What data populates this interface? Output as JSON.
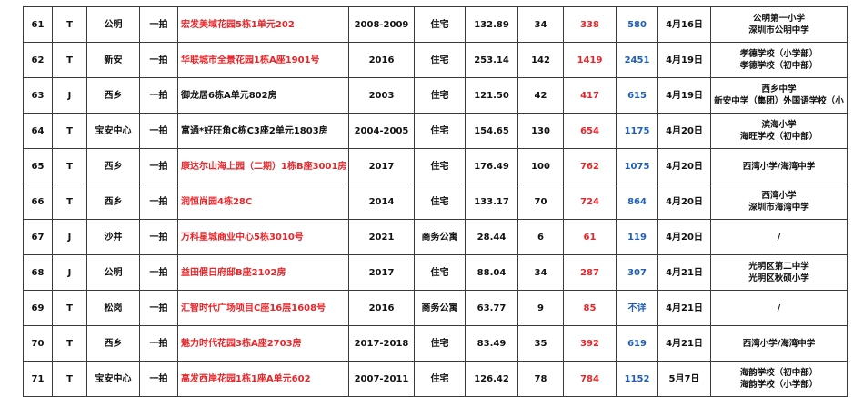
{
  "rows": [
    {
      "no": "61",
      "type": "T",
      "area": "公明",
      "auction": "一拍",
      "address": "宏发美域花园5栋1单元202",
      "address_red": true,
      "year": "2008-2009",
      "usage": "住宅",
      "size": "132.89",
      "age": "34",
      "price": "338",
      "unit": "580",
      "unit_red": false,
      "date": "4月16日",
      "schools": [
        "公明第一小学",
        "深圳市公明中学"
      ]
    },
    {
      "no": "62",
      "type": "T",
      "area": "新安",
      "auction": "一拍",
      "address": "华联城市全景花园1栋A座1901号",
      "address_red": true,
      "year": "2016",
      "usage": "住宅",
      "size": "253.14",
      "age": "142",
      "price": "1419",
      "unit": "2451",
      "unit_red": false,
      "date": "4月19日",
      "schools": [
        "孝德学校（小学部）",
        "孝德学校（初中部）"
      ]
    },
    {
      "no": "63",
      "type": "J",
      "area": "西乡",
      "auction": "一拍",
      "address": "御龙居6栋A单元802房",
      "address_red": false,
      "year": "2003",
      "usage": "住宅",
      "size": "121.50",
      "age": "42",
      "price": "417",
      "unit": "615",
      "unit_red": false,
      "date": "4月19日",
      "schools": [
        "西乡中学",
        "新安中学（集团）外国语学校（小"
      ]
    },
    {
      "no": "64",
      "type": "T",
      "area": "宝安中心",
      "auction": "一拍",
      "address": "富通*好旺角C栋C3座2单元1803房",
      "address_red": false,
      "year": "2004-2005",
      "usage": "住宅",
      "size": "154.65",
      "age": "130",
      "price": "654",
      "unit": "1175",
      "unit_red": false,
      "date": "4月20日",
      "schools": [
        "滨海小学",
        "海旺学校（初中部）"
      ]
    },
    {
      "no": "65",
      "type": "T",
      "area": "西乡",
      "auction": "一拍",
      "address": "康达尔山海上园（二期）1栋B座3001房",
      "address_red": true,
      "year": "2017",
      "usage": "住宅",
      "size": "176.49",
      "age": "100",
      "price": "762",
      "unit": "1075",
      "unit_red": false,
      "date": "4月20日",
      "schools": [
        "西湾小学/海湾中学"
      ]
    },
    {
      "no": "66",
      "type": "T",
      "area": "西乡",
      "auction": "一拍",
      "address": "润恒尚园4栋28C",
      "address_red": true,
      "year": "2014",
      "usage": "住宅",
      "size": "133.17",
      "age": "70",
      "price": "724",
      "unit": "864",
      "unit_red": false,
      "date": "4月20日",
      "schools": [
        "西湾小学",
        "深圳市海湾中学"
      ]
    },
    {
      "no": "67",
      "type": "J",
      "area": "沙井",
      "auction": "一拍",
      "address": "万科星城商业中心5栋3010号",
      "address_red": true,
      "year": "2021",
      "usage": "商务公寓",
      "size": "28.44",
      "age": "6",
      "price": "61",
      "unit": "119",
      "unit_red": false,
      "date": "4月20日",
      "schools": [
        "/"
      ]
    },
    {
      "no": "68",
      "type": "J",
      "area": "公明",
      "auction": "一拍",
      "address": "益田假日府邸B座2102房",
      "address_red": true,
      "year": "2017",
      "usage": "住宅",
      "size": "88.04",
      "age": "34",
      "price": "287",
      "unit": "307",
      "unit_red": false,
      "date": "4月21日",
      "schools": [
        "光明区第二中学",
        "光明区秋硕小学"
      ]
    },
    {
      "no": "69",
      "type": "T",
      "area": "松岗",
      "auction": "一拍",
      "address": "汇智时代广场项目C座16层1608号",
      "address_red": true,
      "year": "2016",
      "usage": "商务公寓",
      "size": "63.77",
      "age": "9",
      "price": "85",
      "unit": "不详",
      "unit_red": false,
      "date": "4月21日",
      "schools": [
        "/"
      ]
    },
    {
      "no": "70",
      "type": "T",
      "area": "西乡",
      "auction": "一拍",
      "address": "魅力时代花园3栋A座2703房",
      "address_red": true,
      "year": "2017-2018",
      "usage": "住宅",
      "size": "83.49",
      "age": "35",
      "price": "392",
      "unit": "619",
      "unit_red": false,
      "date": "4月21日",
      "schools": [
        "西湾小学/海湾中学"
      ]
    },
    {
      "no": "71",
      "type": "T",
      "area": "宝安中心",
      "auction": "一拍",
      "address": "高发西岸花园1栋1座A单元602",
      "address_red": true,
      "year": "2007-2011",
      "usage": "住宅",
      "size": "126.42",
      "age": "78",
      "price": "784",
      "unit": "1152",
      "unit_red": false,
      "date": "5月7日",
      "schools": [
        "海韵学校（初中部）",
        "海韵学校（小学部）"
      ]
    }
  ],
  "colors": {
    "red": "#e8262a",
    "blue": "#1f5fb7",
    "text": "#111111",
    "border": "#3a3a3a"
  }
}
